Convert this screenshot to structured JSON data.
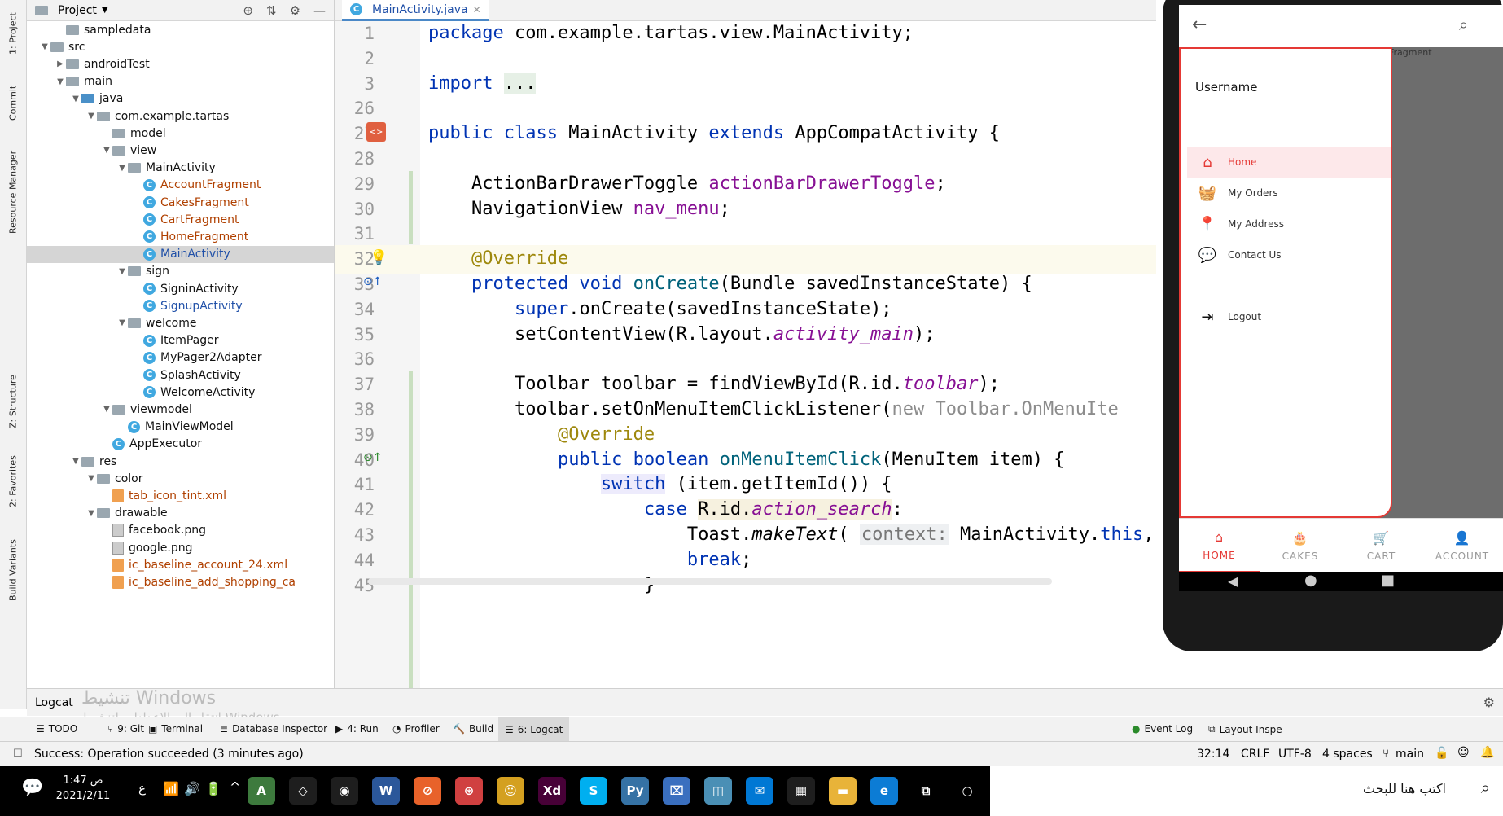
{
  "left_strip": {
    "tabs": [
      "1: Project",
      "Commit",
      "Resource Manager",
      "Z: Structure",
      "2: Favorites",
      "Build Variants"
    ]
  },
  "project_panel": {
    "title": "Project",
    "tree": [
      {
        "label": "sampledata",
        "depth": 2,
        "type": "folder",
        "arrow": ""
      },
      {
        "label": "src",
        "depth": 1,
        "type": "folder",
        "arrow": "▼"
      },
      {
        "label": "androidTest",
        "depth": 2,
        "type": "folder",
        "arrow": "▶"
      },
      {
        "label": "main",
        "depth": 2,
        "type": "folder",
        "arrow": "▼"
      },
      {
        "label": "java",
        "depth": 3,
        "type": "folder-blue",
        "arrow": "▼"
      },
      {
        "label": "com.example.tartas",
        "depth": 4,
        "type": "folder",
        "arrow": "▼"
      },
      {
        "label": "model",
        "depth": 5,
        "type": "folder",
        "arrow": ""
      },
      {
        "label": "view",
        "depth": 5,
        "type": "folder",
        "arrow": "▼"
      },
      {
        "label": "MainActivity",
        "depth": 6,
        "type": "folder",
        "arrow": "▼"
      },
      {
        "label": "AccountFragment",
        "depth": 7,
        "type": "class-orange",
        "arrow": ""
      },
      {
        "label": "CakesFragment",
        "depth": 7,
        "type": "class-orange",
        "arrow": ""
      },
      {
        "label": "CartFragment",
        "depth": 7,
        "type": "class-orange",
        "arrow": ""
      },
      {
        "label": "HomeFragment",
        "depth": 7,
        "type": "class-orange",
        "arrow": ""
      },
      {
        "label": "MainActivity",
        "depth": 7,
        "type": "class-blue",
        "arrow": "",
        "selected": true
      },
      {
        "label": "sign",
        "depth": 6,
        "type": "folder",
        "arrow": "▼"
      },
      {
        "label": "SigninActivity",
        "depth": 7,
        "type": "class",
        "arrow": ""
      },
      {
        "label": "SignupActivity",
        "depth": 7,
        "type": "class-blue",
        "arrow": ""
      },
      {
        "label": "welcome",
        "depth": 6,
        "type": "folder",
        "arrow": "▼"
      },
      {
        "label": "ItemPager",
        "depth": 7,
        "type": "class",
        "arrow": ""
      },
      {
        "label": "MyPager2Adapter",
        "depth": 7,
        "type": "class",
        "arrow": ""
      },
      {
        "label": "SplashActivity",
        "depth": 7,
        "type": "class",
        "arrow": ""
      },
      {
        "label": "WelcomeActivity",
        "depth": 7,
        "type": "class",
        "arrow": ""
      },
      {
        "label": "viewmodel",
        "depth": 5,
        "type": "folder",
        "arrow": "▼"
      },
      {
        "label": "MainViewModel",
        "depth": 6,
        "type": "class",
        "arrow": ""
      },
      {
        "label": "AppExecutor",
        "depth": 5,
        "type": "class",
        "arrow": ""
      },
      {
        "label": "res",
        "depth": 3,
        "type": "folder",
        "arrow": "▼"
      },
      {
        "label": "color",
        "depth": 4,
        "type": "folder",
        "arrow": "▼"
      },
      {
        "label": "tab_icon_tint.xml",
        "depth": 5,
        "type": "xml",
        "arrow": ""
      },
      {
        "label": "drawable",
        "depth": 4,
        "type": "folder",
        "arrow": "▼"
      },
      {
        "label": "facebook.png",
        "depth": 5,
        "type": "png",
        "arrow": ""
      },
      {
        "label": "google.png",
        "depth": 5,
        "type": "png",
        "arrow": ""
      },
      {
        "label": "ic_baseline_account_24.xml",
        "depth": 5,
        "type": "xml",
        "arrow": ""
      },
      {
        "label": "ic_baseline_add_shopping_ca",
        "depth": 5,
        "type": "xml",
        "arrow": ""
      }
    ]
  },
  "editor": {
    "tab_label": "MainActivity.java",
    "lines": [
      {
        "num": "1",
        "html": "<span class='kw'>package</span> com.example.tartas.view.MainActivity;"
      },
      {
        "num": "2",
        "html": ""
      },
      {
        "num": "3",
        "html": "<span class='kw'>import</span> <span style='background:#e6f0e6'>...</span>"
      },
      {
        "num": "26",
        "html": ""
      },
      {
        "num": "27",
        "html": "<span class='kw'>public class</span> MainActivity <span class='kw'>extends</span> AppCompatActivity {"
      },
      {
        "num": "28",
        "html": ""
      },
      {
        "num": "29",
        "html": "    ActionBarDrawerToggle <span class='fld'>actionBarDrawerToggle</span>;"
      },
      {
        "num": "30",
        "html": "    NavigationView <span class='fld'>nav_menu</span>;"
      },
      {
        "num": "31",
        "html": ""
      },
      {
        "num": "32",
        "html": "    <span class='ann'>@Override</span>",
        "highlight": true
      },
      {
        "num": "33",
        "html": "    <span class='kw'>protected void</span> <span style='color:#00627a'>onCreate</span>(Bundle savedInstanceState) {"
      },
      {
        "num": "34",
        "html": "        <span class='kw'>super</span>.onCreate(savedInstanceState);"
      },
      {
        "num": "35",
        "html": "        setContentView(R.layout.<span class='fld ital'>activity_main</span>);"
      },
      {
        "num": "36",
        "html": ""
      },
      {
        "num": "37",
        "html": "        Toolbar toolbar = findViewById(R.id.<span class='fld ital'>toolbar</span>);"
      },
      {
        "num": "38",
        "html": "        toolbar.setOnMenuItemClickListener(<span class='gray'>new Toolbar.OnMenuIte</span>"
      },
      {
        "num": "39",
        "html": "            <span class='ann'>@Override</span>"
      },
      {
        "num": "40",
        "html": "            <span class='kw'>public boolean</span> <span style='color:#00627a'>onMenuItemClick</span>(MenuItem item) {"
      },
      {
        "num": "41",
        "html": "                <span class='kw' style='background:#edebfc'>switch</span> (item.getItemId()) {"
      },
      {
        "num": "42",
        "html": "                    <span class='kw'>case</span> <span style='background:#f6f1df'>R.id.<span class='fld ital'>action_search</span></span>:"
      },
      {
        "num": "43",
        "html": "                        Toast.<span class='ital'>makeText</span>( <span class='hint'>context:</span> MainActivity.<span class='kw'>this</span>,"
      },
      {
        "num": "44",
        "html": "                        <span class='kw'>break</span>;"
      },
      {
        "num": "45",
        "html": "                    }"
      }
    ]
  },
  "emulator": {
    "fragment_label": "Home Fragment",
    "username": "Username",
    "drawer_items": [
      {
        "label": "Home",
        "icon": "home-icon",
        "glyph": "⌂",
        "active": true
      },
      {
        "label": "My Orders",
        "icon": "basket-icon",
        "glyph": "🧺",
        "active": false
      },
      {
        "label": "My Address",
        "icon": "location-pin-icon",
        "glyph": "📍",
        "active": false
      },
      {
        "label": "Contact Us",
        "icon": "chat-icon",
        "glyph": "💬",
        "active": false
      },
      {
        "label": "Logout",
        "icon": "logout-icon",
        "glyph": "⇥",
        "active": false
      }
    ],
    "bottom_nav": [
      {
        "label": "HOME",
        "icon": "home-icon",
        "glyph": "⌂",
        "active": true
      },
      {
        "label": "CAKES",
        "icon": "cake-icon",
        "glyph": "🎂",
        "active": false
      },
      {
        "label": "CART",
        "icon": "cart-icon",
        "glyph": "🛒",
        "active": false
      },
      {
        "label": "ACCOUNT",
        "icon": "person-icon",
        "glyph": "👤",
        "active": false
      }
    ],
    "accent_color": "#e53935"
  },
  "logcat_bar": {
    "label": "Logcat"
  },
  "watermark": {
    "line1": "تنشيط Windows",
    "line2": "انتقل إلى الإعدادات لتنشيط Windows."
  },
  "toolwindows": [
    {
      "label": "TODO",
      "icon": "list-icon",
      "glyph": "☰"
    },
    {
      "label": "9: Git",
      "icon": "git-icon",
      "glyph": "⑂"
    },
    {
      "label": "Terminal",
      "icon": "terminal-icon",
      "glyph": "▣"
    },
    {
      "label": "Database Inspector",
      "icon": "database-icon",
      "glyph": "≣"
    },
    {
      "label": "4: Run",
      "icon": "run-icon",
      "glyph": "▶"
    },
    {
      "label": "Profiler",
      "icon": "profiler-icon",
      "glyph": "◔"
    },
    {
      "label": "Build",
      "icon": "hammer-icon",
      "glyph": "🔨"
    },
    {
      "label": "6: Logcat",
      "icon": "logcat-icon",
      "glyph": "☰",
      "active": true
    }
  ],
  "toolwindows_right": [
    {
      "label": "Event Log",
      "icon": "event-log-icon",
      "glyph": "●"
    },
    {
      "label": "Layout Inspe",
      "icon": "layout-inspector-icon",
      "glyph": "⧉"
    }
  ],
  "status_bar": {
    "message": "Success: Operation succeeded (3 minutes ago)",
    "position": "32:14",
    "line_sep": "CRLF",
    "encoding": "UTF-8",
    "indent": "4 spaces",
    "branch": "main"
  },
  "taskbar": {
    "time": "1:47 ص",
    "date": "2021/2/11",
    "lang": "ع",
    "search_text": "اكتب هنا للبحث",
    "apps": [
      {
        "name": "android-studio-icon",
        "glyph": "A",
        "color": "#3d7a3d"
      },
      {
        "name": "app-icon-2",
        "glyph": "◇",
        "color": "#1e1e1e"
      },
      {
        "name": "chrome-icon",
        "glyph": "◉",
        "color": "#1e1e1e"
      },
      {
        "name": "word-icon",
        "glyph": "W",
        "color": "#2b579a"
      },
      {
        "name": "app-icon-5",
        "glyph": "⊘",
        "color": "#e8622a"
      },
      {
        "name": "app-icon-6",
        "glyph": "⊛",
        "color": "#d04040"
      },
      {
        "name": "app-icon-7",
        "glyph": "☺",
        "color": "#d4a020"
      },
      {
        "name": "xd-icon",
        "glyph": "Xd",
        "color": "#470137"
      },
      {
        "name": "skype-icon",
        "glyph": "S",
        "color": "#00aff0"
      },
      {
        "name": "python-icon",
        "glyph": "Py",
        "color": "#3572a5"
      },
      {
        "name": "app-icon-11",
        "glyph": "⌧",
        "color": "#3a6fbf"
      },
      {
        "name": "app-icon-12",
        "glyph": "◫",
        "color": "#4a8fb5"
      },
      {
        "name": "mail-icon",
        "glyph": "✉",
        "color": "#0078d4"
      },
      {
        "name": "store-icon",
        "glyph": "▦",
        "color": "#1e1e1e"
      },
      {
        "name": "file-explorer-icon",
        "glyph": "▬",
        "color": "#e8b339"
      },
      {
        "name": "edge-icon",
        "glyph": "e",
        "color": "#0c7cd5"
      },
      {
        "name": "task-view-icon",
        "glyph": "⧉",
        "color": "#000"
      },
      {
        "name": "cortana-icon",
        "glyph": "○",
        "color": "#000"
      }
    ]
  }
}
